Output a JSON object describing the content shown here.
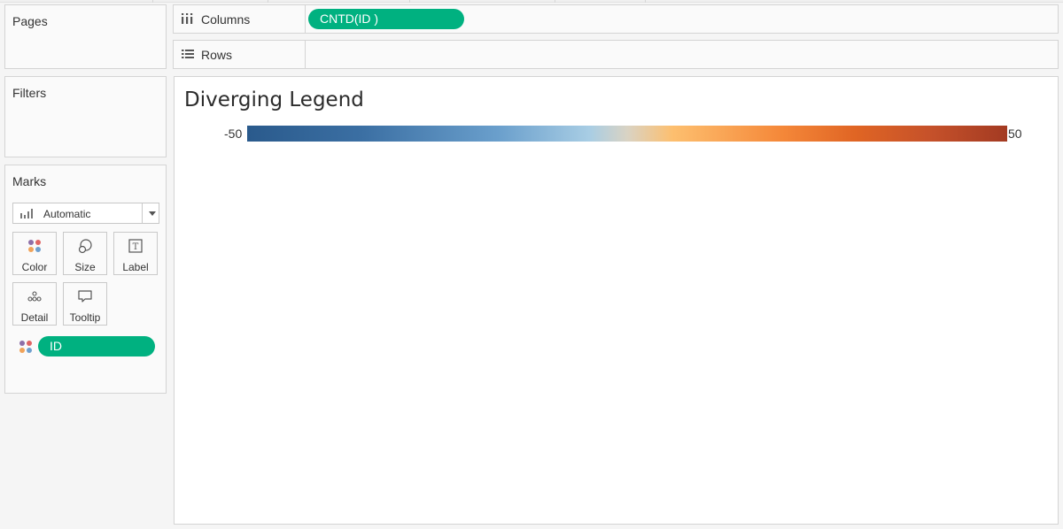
{
  "side_panel": {
    "pages_title": "Pages",
    "filters_title": "Filters",
    "marks": {
      "title": "Marks",
      "mark_type": "Automatic",
      "buttons": {
        "color": "Color",
        "size": "Size",
        "label": "Label",
        "detail": "Detail",
        "tooltip": "Tooltip"
      },
      "color_field": "ID"
    }
  },
  "shelves": {
    "columns_label": "Columns",
    "columns_pill": "CNTD(ID )",
    "rows_label": "Rows"
  },
  "view": {
    "title": "Diverging Legend",
    "legend_min": "-50",
    "legend_max": "50"
  },
  "colors": {
    "pill": "#00b180",
    "legend_low": "#2a5a8c",
    "legend_mid": "#d9d3c4",
    "legend_high": "#a33a22"
  },
  "icons": {
    "columns": "columns-icon",
    "rows": "rows-icon",
    "mark_type": "bar-chart-icon",
    "color": "color-dots-icon",
    "size": "size-circles-icon",
    "label": "text-t-icon",
    "detail": "detail-dots-icon",
    "tooltip": "speech-bubble-icon"
  }
}
